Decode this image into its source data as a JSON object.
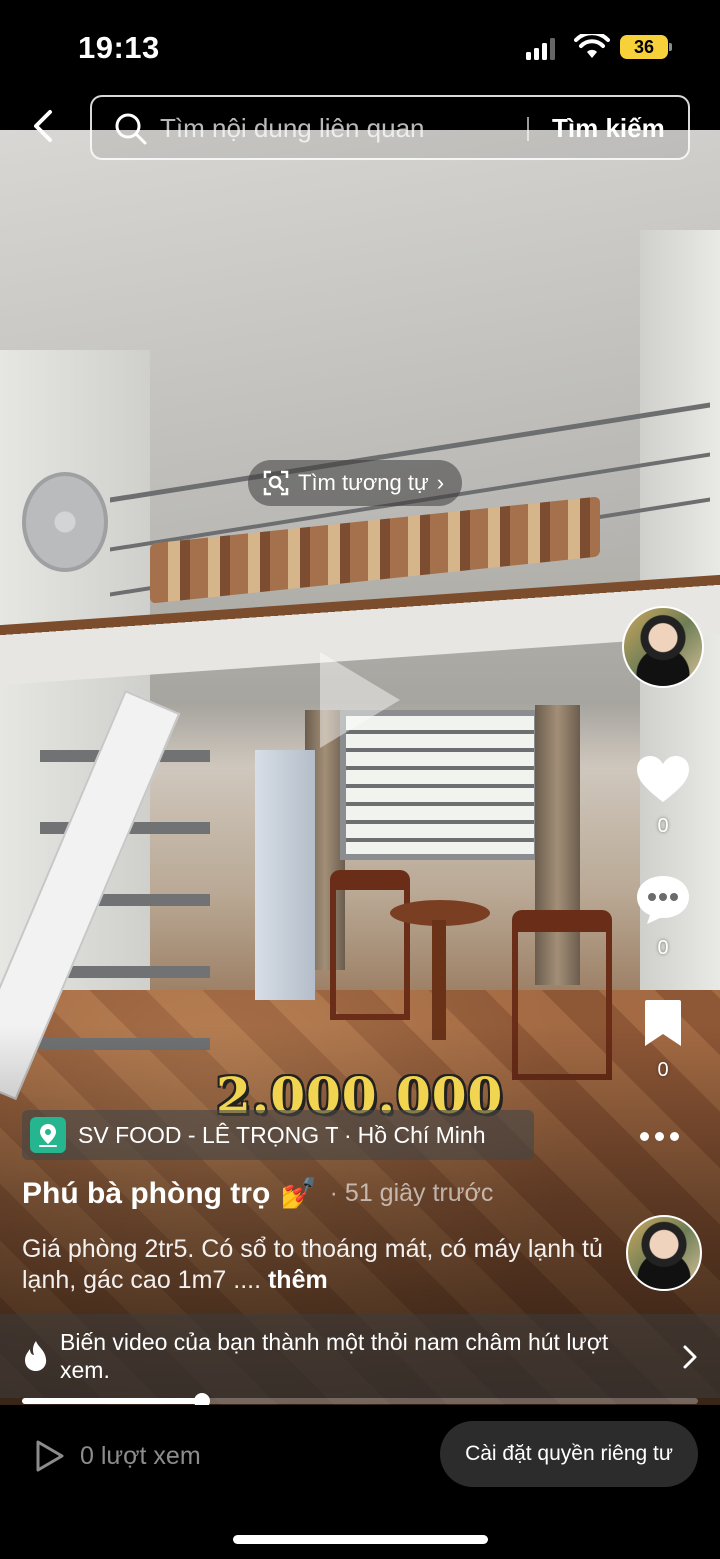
{
  "status_bar": {
    "time": "19:13",
    "battery": "36"
  },
  "search": {
    "placeholder": "Tìm nội dung liên quan",
    "button_label": "Tìm kiếm"
  },
  "similar": {
    "label": "Tìm tương tự",
    "chevron": "›"
  },
  "actions": {
    "likes": "0",
    "comments": "0",
    "saves": "0"
  },
  "overlay": {
    "price": "2.000.000"
  },
  "location": {
    "name": "SV FOOD - LÊ TRỌNG T...",
    "separator": "·",
    "city": "Hồ Chí Minh"
  },
  "post": {
    "title": "Phú bà phòng trọ",
    "emoji": "💅",
    "timestamp": "· 51 giây trước",
    "description": "Giá phòng 2tr5. Có sổ to thoáng mát, có máy lạnh tủ lạnh, gác cao 1m7 ....",
    "more_label": "thêm"
  },
  "promo": {
    "text": "Biến video của bạn thành một thỏi nam châm hút lượt xem."
  },
  "playback": {
    "progress": 0.267
  },
  "bottom_bar": {
    "views": "0 lượt xem",
    "privacy_button": "Cài đặt quyền riêng tư"
  },
  "icons": [
    "back-icon",
    "search-icon",
    "scan-icon",
    "heart-icon",
    "comment-icon",
    "bookmark-icon",
    "more-icon",
    "pin-icon",
    "flame-icon",
    "chevron-right-icon",
    "play-icon"
  ],
  "colors": {
    "price": "#f1d44f",
    "pin_badge": "#25b58f",
    "battery": "#f7d13a"
  }
}
